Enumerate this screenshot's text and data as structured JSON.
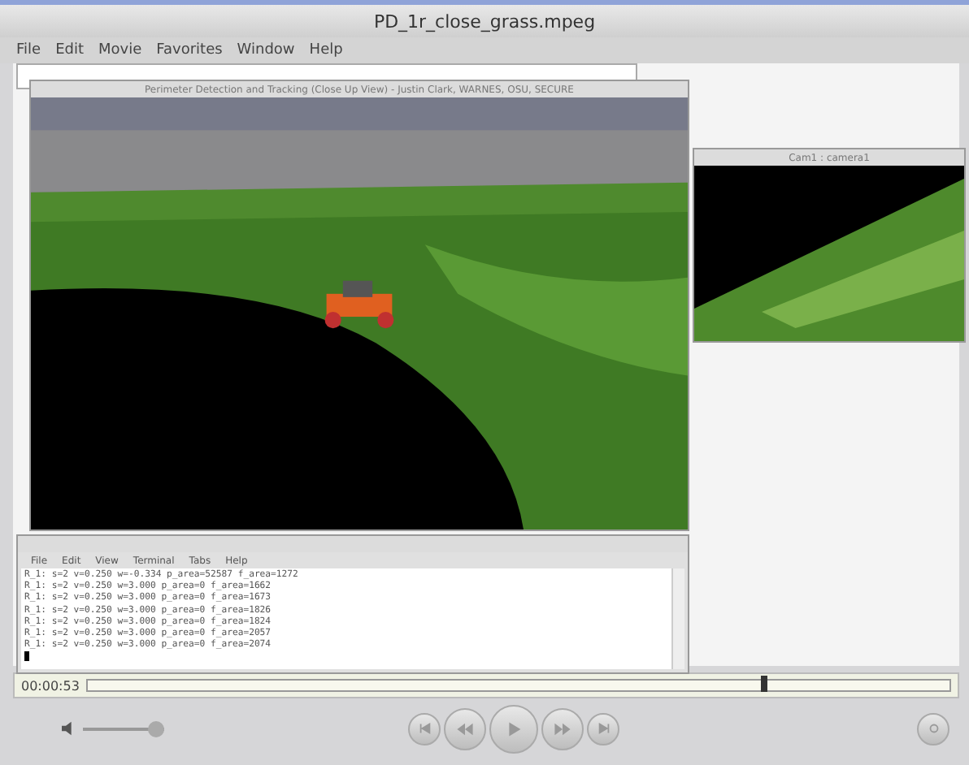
{
  "window": {
    "title": "PD_1r_close_grass.mpeg"
  },
  "menu": [
    "File",
    "Edit",
    "Movie",
    "Favorites",
    "Window",
    "Help"
  ],
  "video": {
    "sim_window": {
      "title": "Perimeter Detection and Tracking (Close Up View) - Justin Clark, WARNES, OSU, SECURE"
    },
    "cam_window": {
      "title": "Cam1 : camera1"
    },
    "terminal": {
      "menu": [
        "File",
        "Edit",
        "View",
        "Terminal",
        "Tabs",
        "Help"
      ],
      "lines": [
        "R_1: s=2 v=0.250 w=-0.334 p_area=52587 f_area=1272",
        "R_1: s=2 v=0.250 w=3.000 p_area=0 f_area=1662",
        "R_1: s=2 v=0.250 w=3.000 p_area=0 f_area=1673",
        "R_1: s=2 v=0.250 w=3.000 p_area=0 f_area=1826",
        "R_1: s=2 v=0.250 w=3.000 p_area=0 f_area=1824",
        "R_1: s=2 v=0.250 w=3.000 p_area=0 f_area=2057",
        "R_1: s=2 v=0.250 w=3.000 p_area=0 f_area=2074"
      ]
    }
  },
  "time": "00:00:53",
  "progress": {
    "level": 0.785
  },
  "volume": {
    "level": 1.0
  }
}
